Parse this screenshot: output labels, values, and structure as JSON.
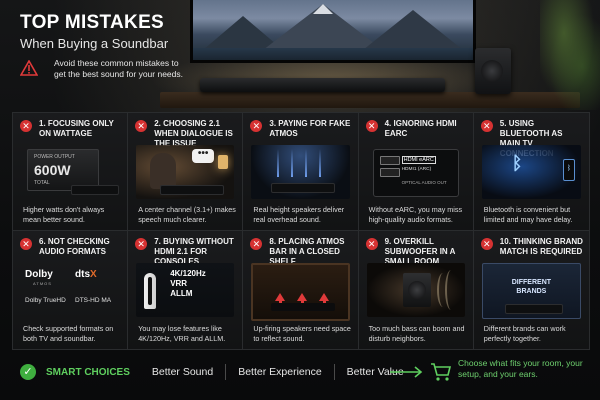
{
  "header": {
    "title": "TOP MISTAKES",
    "subtitle": "When Buying a Soundbar",
    "warning_text": "Avoid these common mistakes to get the best sound for your needs."
  },
  "cards": [
    {
      "number": "1.",
      "title": "FOCUSING ONLY ON WATTAGE",
      "description": "Higher watts don't always mean better sound.",
      "art": {
        "label": "POWER OUTPUT",
        "value": "600W",
        "total": "TOTAL"
      }
    },
    {
      "number": "2.",
      "title": "CHOOSING 2.1 WHEN DIALOGUE IS THE ISSUE",
      "description": "A center channel (3.1+) makes speech much clearer.",
      "art": {
        "bubble": "•••"
      }
    },
    {
      "number": "3.",
      "title": "PAYING FOR FAKE ATMOS",
      "description": "Real height speakers deliver real overhead sound."
    },
    {
      "number": "4.",
      "title": "IGNORING HDMI eARC",
      "description": "Without eARC, you may miss high-quality audio formats.",
      "art": {
        "port1": "HDMI eARC",
        "port2": "HDMI1 (ARC)",
        "port3": "OPTICAL AUDIO OUT"
      }
    },
    {
      "number": "5.",
      "title": "USING BLUETOOTH AS MAIN TV CONNECTION",
      "description": "Bluetooth is convenient but limited and may have delay."
    },
    {
      "number": "6.",
      "title": "NOT CHECKING AUDIO FORMATS",
      "description": "Check supported formats on both TV and soundbar.",
      "art": {
        "dolby": "Dolby",
        "dolby_sub": "ATMOS",
        "dts": "dts",
        "dts_x": "X",
        "truehd": "Dolby TrueHD",
        "dtshd": "DTS-HD MA"
      }
    },
    {
      "number": "7.",
      "title": "BUYING WITHOUT HDMI 2.1 FOR CONSOLES",
      "description": "You may lose features like 4K/120Hz, VRR and ALLM.",
      "art": {
        "spec1": "4K/120Hz",
        "spec2": "VRR",
        "spec3": "ALLM"
      }
    },
    {
      "number": "8.",
      "title": "PLACING ATMOS BAR IN A CLOSED SHELF",
      "description": "Up-firing speakers need space to reflect sound."
    },
    {
      "number": "9.",
      "title": "OVERKILL SUBWOOFER IN A SMALL ROOM",
      "description": "Too much bass can boom and disturb neighbors."
    },
    {
      "number": "10.",
      "title": "THINKING BRAND MATCH IS REQUIRED",
      "description": "Different brands can work perfectly together.",
      "art": {
        "brands": "DIFFERENT BRANDS"
      }
    }
  ],
  "footer": {
    "label": "SMART CHOICES",
    "items": [
      "Better Sound",
      "Better Experience",
      "Better Value"
    ],
    "note": "Choose what fits your room, your setup, and your ears."
  },
  "icons": {
    "warning": "warning-triangle-icon",
    "mistake": "x-circle-icon",
    "check": "check-circle-icon",
    "cart": "shopping-cart-icon",
    "bluetooth": "bluetooth-icon"
  },
  "colors": {
    "mistake_red": "#d63232",
    "smart_green": "#3fae3f",
    "footer_note_green": "#6fd16f"
  }
}
